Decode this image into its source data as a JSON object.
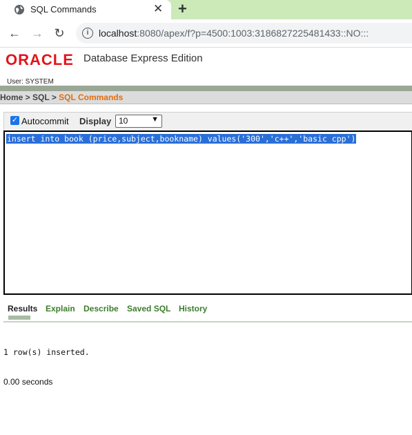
{
  "browser": {
    "tab_title": "SQL Commands",
    "close_glyph": "✕",
    "new_tab_glyph": "+",
    "url_host": "localhost",
    "url_rest": ":8080/apex/f?p=4500:1003:3186827225481433::NO:::",
    "nav": {
      "back": "←",
      "forward": "→",
      "reload": "↻"
    },
    "info_glyph": "i"
  },
  "header": {
    "logo": "ORACLE",
    "product": "Database Express Edition",
    "user_line": "User: SYSTEM"
  },
  "breadcrumb": {
    "home": "Home",
    "sep1": " > ",
    "sql": "SQL",
    "sep2": " > ",
    "current": "SQL Commands"
  },
  "command": {
    "autocommit_label": "Autocommit",
    "autocommit_checked": true,
    "display_label": "Display",
    "display_value": "10",
    "sql_text": "insert into book (price,subject,bookname) values('300','c++','basic cpp')"
  },
  "results": {
    "tabs": [
      "Results",
      "Explain",
      "Describe",
      "Saved SQL",
      "History"
    ],
    "active_tab": "Results",
    "message": "1 row(s) inserted.",
    "timing": "0.00 seconds"
  },
  "colors": {
    "oracle_red": "#e2141c",
    "breadcrumb_current": "#e46c0a",
    "tab_green": "#3a7d2a",
    "selection_blue": "#2a6fd8",
    "tabstrip_green": "#cce9b8"
  },
  "icons": [
    "globe-icon",
    "close-icon",
    "plus-icon",
    "back-arrow-icon",
    "forward-arrow-icon",
    "reload-icon",
    "info-icon",
    "checkbox-icon",
    "chevron-down-icon"
  ]
}
